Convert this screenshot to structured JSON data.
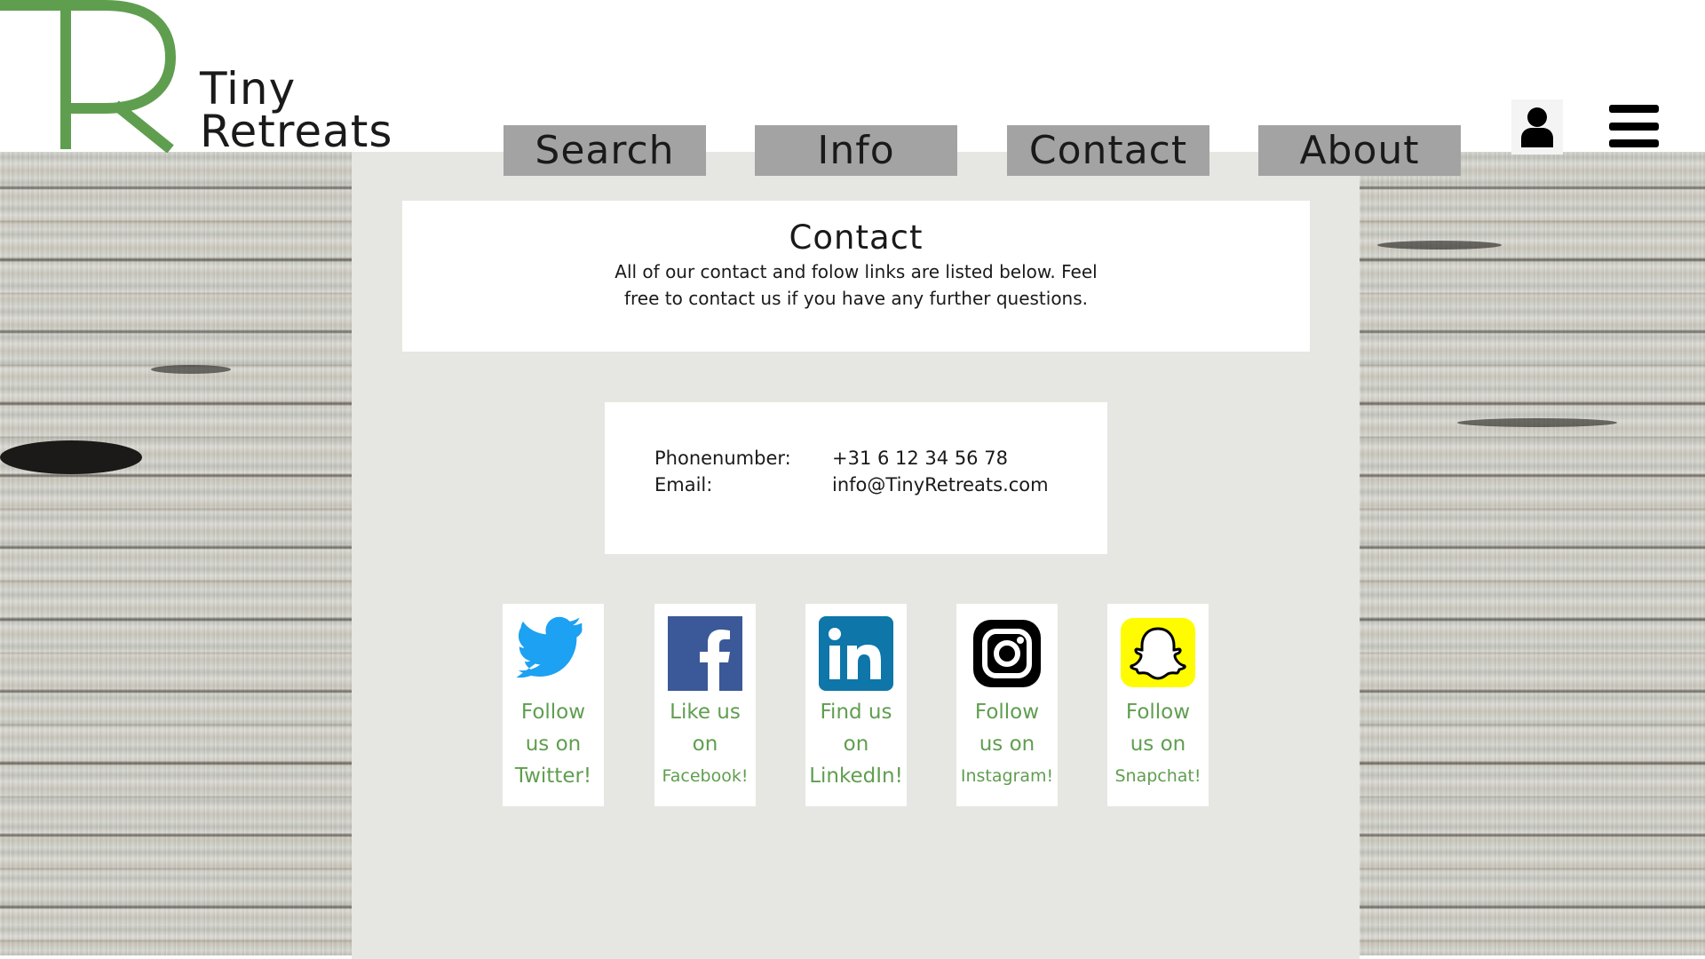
{
  "brand": {
    "name_line1": "Tiny",
    "name_line2": "Retreats",
    "mark_letters": "TR",
    "mark_color": "#5f9e4f"
  },
  "nav": {
    "items": [
      "Search",
      "Info",
      "Contact",
      "About"
    ]
  },
  "header_icons": {
    "user": "user-icon",
    "menu": "hamburger-menu-icon"
  },
  "contact": {
    "title": "Contact",
    "description": "All of our contact and folow links are listed below. Feel free to contact us if you have any further questions."
  },
  "info": {
    "phone_label": "Phonenumber:",
    "phone_value": "+31 6 12 34 56 78",
    "email_label": "Email:",
    "email_value": "info@TinyRetreats.com"
  },
  "social": [
    {
      "icon": "twitter-icon",
      "line1": "Follow",
      "line2": "us on",
      "line3": "Twitter!",
      "color": "#1da1f2"
    },
    {
      "icon": "facebook-icon",
      "line1": "Like us",
      "line2": "on",
      "line3": "Facebook!",
      "color": "#3b5998"
    },
    {
      "icon": "linkedin-icon",
      "line1": "Find us",
      "line2": "on",
      "line3": "LinkedIn!",
      "color": "#0e76a8"
    },
    {
      "icon": "instagram-icon",
      "line1": "Follow",
      "line2": "us on",
      "line3": "Instagram!",
      "color": "#000000"
    },
    {
      "icon": "snapchat-icon",
      "line1": "Follow",
      "line2": "us on",
      "line3": "Snapchat!",
      "color": "#fffc00"
    }
  ],
  "colors": {
    "accent_green": "#5f9e4f",
    "nav_gray": "#a3a3a3",
    "panel_bg": "#e6e7e2"
  }
}
